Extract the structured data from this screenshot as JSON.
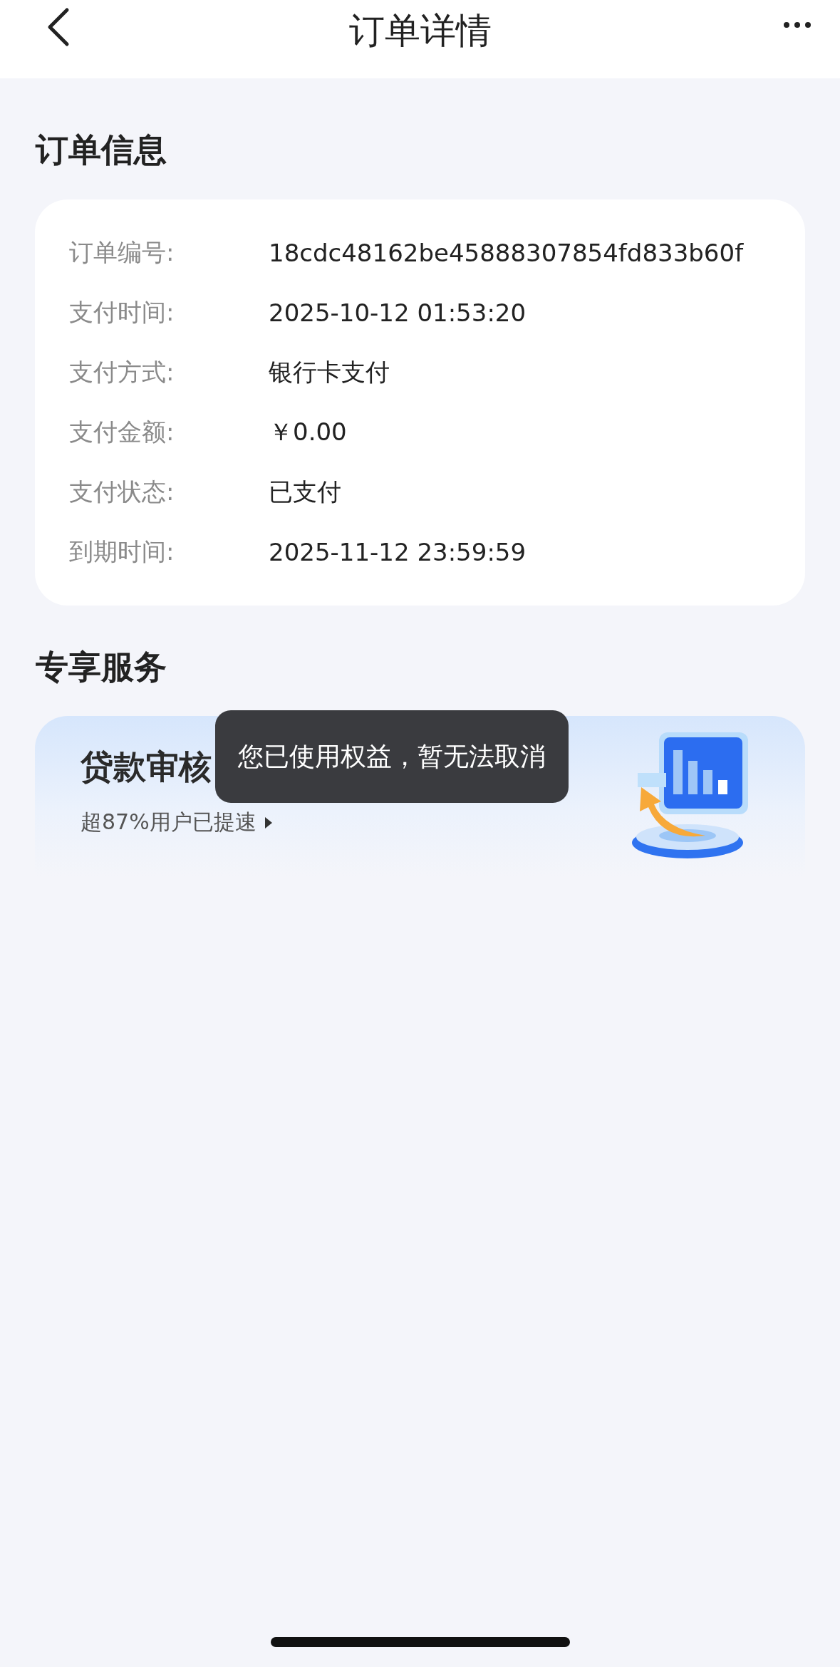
{
  "header": {
    "title": "订单详情"
  },
  "order_section": {
    "title": "订单信息",
    "rows": [
      {
        "label": "订单编号:",
        "value": "18cdc48162be45888307854fd833b60f"
      },
      {
        "label": "支付时间:",
        "value": "2025-10-12 01:53:20"
      },
      {
        "label": "支付方式:",
        "value": "银行卡支付"
      },
      {
        "label": "支付金额:",
        "value": "￥0.00"
      },
      {
        "label": "支付状态:",
        "value": "已支付"
      },
      {
        "label": "到期时间:",
        "value": "2025-11-12 23:59:59"
      }
    ]
  },
  "service_section": {
    "title": "专享服务",
    "banner": {
      "title": "贷款审核",
      "subtitle": "超87%用户已提速"
    }
  },
  "toast": {
    "text": "您已使用权益，暂无法取消"
  }
}
